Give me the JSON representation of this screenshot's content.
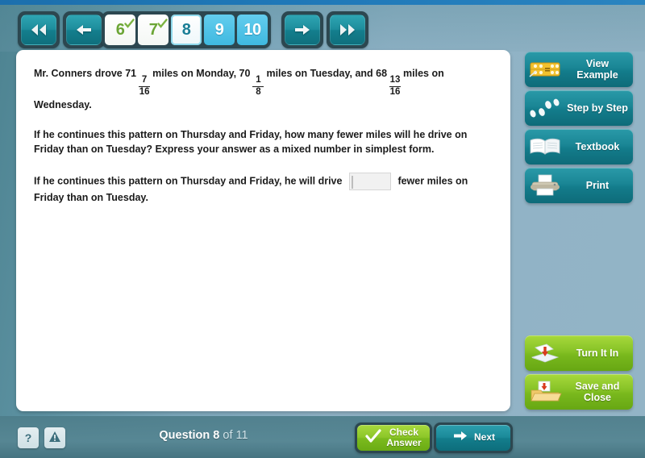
{
  "app": {
    "question_counter_label": "Question",
    "question_number": "8",
    "question_total_label": "of 11"
  },
  "nav": {
    "first_icon": "rewind-double-left-icon",
    "prev_icon": "arrow-left-icon",
    "next_icon": "arrow-right-icon",
    "last_icon": "forward-double-right-icon",
    "pages": [
      {
        "label": "6",
        "state": "done"
      },
      {
        "label": "7",
        "state": "done"
      },
      {
        "label": "8",
        "state": "current"
      },
      {
        "label": "9",
        "state": "todo"
      },
      {
        "label": "10",
        "state": "todo"
      }
    ]
  },
  "problem": {
    "p1": {
      "a": "Mr. Conners drove 71",
      "f1_num": "7",
      "f1_den": "16",
      "b": "miles on Monday, 70",
      "f2_num": "1",
      "f2_den": "8",
      "c": "miles on Tuesday, and 68",
      "f3_num": "13",
      "f3_den": "16",
      "d": "miles on Wednesday."
    },
    "p2": "If he continues this pattern on Thursday and Friday, how many fewer miles will he drive on Friday than on Tuesday? Express your answer as a mixed number in simplest form.",
    "p3a": "If he continues this pattern on Thursday and Friday, he will drive",
    "answer_value": "",
    "p3b": "fewer miles on Friday than on Tuesday."
  },
  "sidebar": {
    "top": [
      {
        "label": "View Example",
        "icon": "abacus-icon",
        "style": "teal"
      },
      {
        "label": "Step by Step",
        "icon": "footprints-icon",
        "style": "teal"
      },
      {
        "label": "Textbook",
        "icon": "open-book-icon",
        "style": "teal"
      },
      {
        "label": "Print",
        "icon": "printer-icon",
        "style": "teal"
      }
    ],
    "bottom": [
      {
        "label": "Turn It In",
        "icon": "inbox-tray-icon",
        "style": "green"
      },
      {
        "label": "Save and Close",
        "icon": "save-folder-icon",
        "style": "green"
      }
    ]
  },
  "footer": {
    "help_label": "?",
    "help_icon": "question-mark-icon",
    "alert_icon": "warning-triangle-icon",
    "check_answer_label": "Check Answer",
    "check_icon": "checkmark-icon",
    "next_label": "Next",
    "next_icon": "arrow-right-icon"
  },
  "colors": {
    "accent_teal": "#1a8695",
    "accent_green": "#86c226",
    "page_todo_blue": "#3fb9e0",
    "page_done_green": "#6ba535",
    "panel_white": "#ffffff",
    "top_strip_blue": "#1f78b8"
  }
}
